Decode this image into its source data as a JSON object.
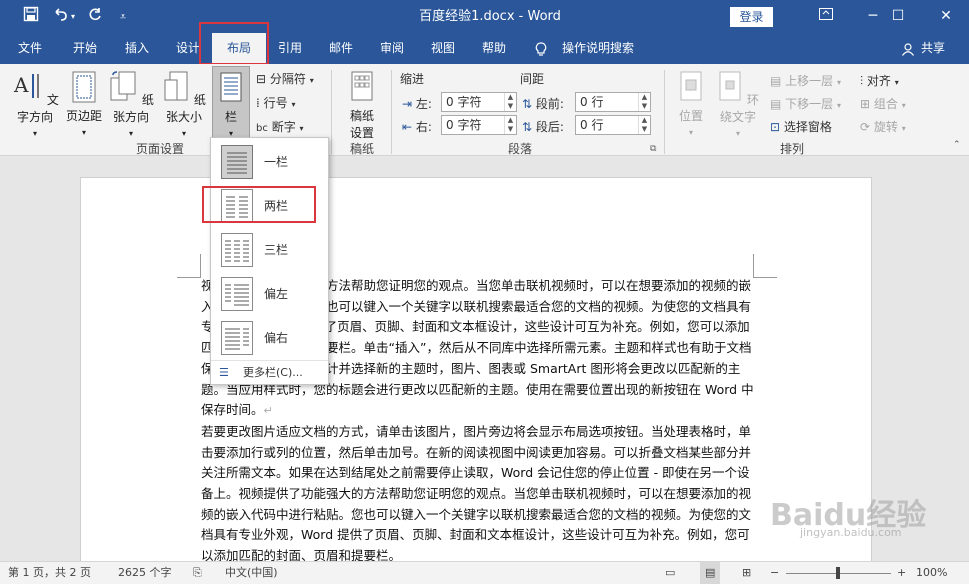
{
  "titlebar": {
    "title": "百度经验1.docx  -  Word",
    "login_label": "登录",
    "icons": [
      "save-icon",
      "undo-icon",
      "redo-icon",
      "customize-qat-icon",
      "ribbon-display-icon",
      "minimize-icon",
      "restore-icon",
      "close-icon"
    ]
  },
  "tabs": [
    {
      "label": "文件"
    },
    {
      "label": "开始"
    },
    {
      "label": "插入"
    },
    {
      "label": "设计"
    },
    {
      "label": "布局"
    },
    {
      "label": "引用"
    },
    {
      "label": "邮件"
    },
    {
      "label": "审阅"
    },
    {
      "label": "视图"
    },
    {
      "label": "帮助"
    },
    {
      "label": "操作说明搜索"
    }
  ],
  "active_tab": "布局",
  "share_label": "共享",
  "ribbon": {
    "page_setup": {
      "text_direction": "文字方向",
      "margins": "页边距",
      "orientation": "纸张方向",
      "size": "纸张大小",
      "columns": "栏",
      "breaks": "分隔符",
      "line_numbers": "行号",
      "hyphenation": "断字",
      "group_label": "页面设置"
    },
    "draft": {
      "button_line1": "稿纸",
      "button_line2": "设置",
      "group_label": "稿纸"
    },
    "paragraph": {
      "indent_header": "缩进",
      "spacing_header": "间距",
      "left_label": "左:",
      "left_value": "0 字符",
      "right_label": "右:",
      "right_value": "0 字符",
      "before_label": "段前:",
      "before_value": "0 行",
      "after_label": "段后:",
      "after_value": "0 行",
      "group_label": "段落"
    },
    "arrange": {
      "position": "位置",
      "wrap_text": "环绕文字",
      "bring_forward": "上移一层",
      "send_backward": "下移一层",
      "selection_pane": "选择窗格",
      "align": "对齐",
      "group": "组合",
      "rotate": "旋转",
      "group_label": "排列"
    }
  },
  "columns_menu": {
    "items": [
      {
        "label": "一栏"
      },
      {
        "label": "两栏"
      },
      {
        "label": "三栏"
      },
      {
        "label": "偏左"
      },
      {
        "label": "偏右"
      }
    ],
    "more": "更多栏(C)...",
    "selected": "一栏",
    "highlighted": "两栏"
  },
  "document": {
    "paragraphs": [
      "视频提供了功能强大的方法帮助您证明您的观点。当您单击联机视频时，可以在想要添加的视频的嵌入代码中进行粘贴。您也可以键入一个关键字以联机搜索最适合您的文档的视频。为使您的文档具有专业外观，Word 提供了页眉、页脚、封面和文本框设计，这些设计可互为补充。例如，您可以添加匹配的封面、页眉和提要栏。单击“插入”，然后从不同库中选择所需元素。主题和样式也有助于文档保持协调。当您单击设计并选择新的主题时，图片、图表或 SmartArt 图形将会更改以匹配新的主题。当应用样式时，您的标题会进行更改以匹配新的主题。使用在需要位置出现的新按钮在 Word 中保存时间。",
      "若要更改图片适应文档的方式，请单击该图片，图片旁边将会显示布局选项按钮。当处理表格时，单击要添加行或列的位置，然后单击加号。在新的阅读视图中阅读更加容易。可以折叠文档某些部分并关注所需文本。如果在达到结尾处之前需要停止读取，Word 会记住您的停止位置 - 即使在另一个设备上。视频提供了功能强大的方法帮助您证明您的观点。当您单击联机视频时，可以在想要添加的视频的嵌入代码中进行粘贴。您也可以键入一个关键字以联机搜索最适合您的文档的视频。为使您的文档具有专业外观，Word 提供了页眉、页脚、封面和文本框设计，这些设计可互为补充。例如，您可以添加匹配的封面、页眉和提要栏。"
    ]
  },
  "statusbar": {
    "page": "第 1 页，共 2 页",
    "words": "2625 个字",
    "language": "中文(中国)",
    "zoom": "100%"
  },
  "watermark": {
    "text": "Baidu经验",
    "url": "jingyan.baidu.com"
  },
  "colors": {
    "title_bar": "#2b579a",
    "highlight": "#d9363e",
    "ribbon_bg": "#f3f3f3"
  }
}
